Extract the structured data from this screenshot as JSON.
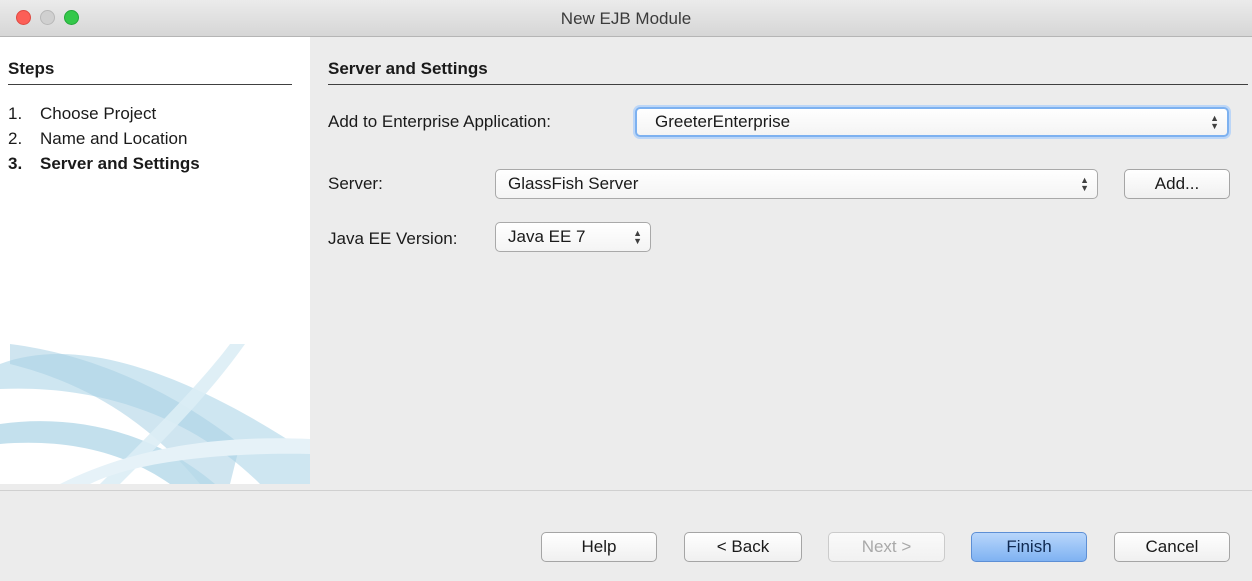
{
  "window": {
    "title": "New EJB Module"
  },
  "steps": {
    "heading": "Steps",
    "items": [
      {
        "number": "1.",
        "label": "Choose Project",
        "current": false
      },
      {
        "number": "2.",
        "label": "Name and Location",
        "current": false
      },
      {
        "number": "3.",
        "label": "Server and Settings",
        "current": true
      }
    ]
  },
  "panel": {
    "heading": "Server and Settings",
    "enterprise_app": {
      "label": "Add to Enterprise Application:",
      "value": "GreeterEnterprise"
    },
    "server": {
      "label": "Server:",
      "value": "GlassFish Server",
      "add_button": "Add..."
    },
    "java_ee": {
      "label": "Java EE Version:",
      "value": "Java EE 7"
    }
  },
  "footer": {
    "help": "Help",
    "back": "< Back",
    "next": "Next >",
    "finish": "Finish",
    "cancel": "Cancel"
  },
  "colors": {
    "close": "#fc5f57",
    "minimize": "#d0d0d0",
    "maximize": "#34c84a",
    "default_button": "#7fb2f2",
    "focus_ring": "#7db1f0"
  }
}
